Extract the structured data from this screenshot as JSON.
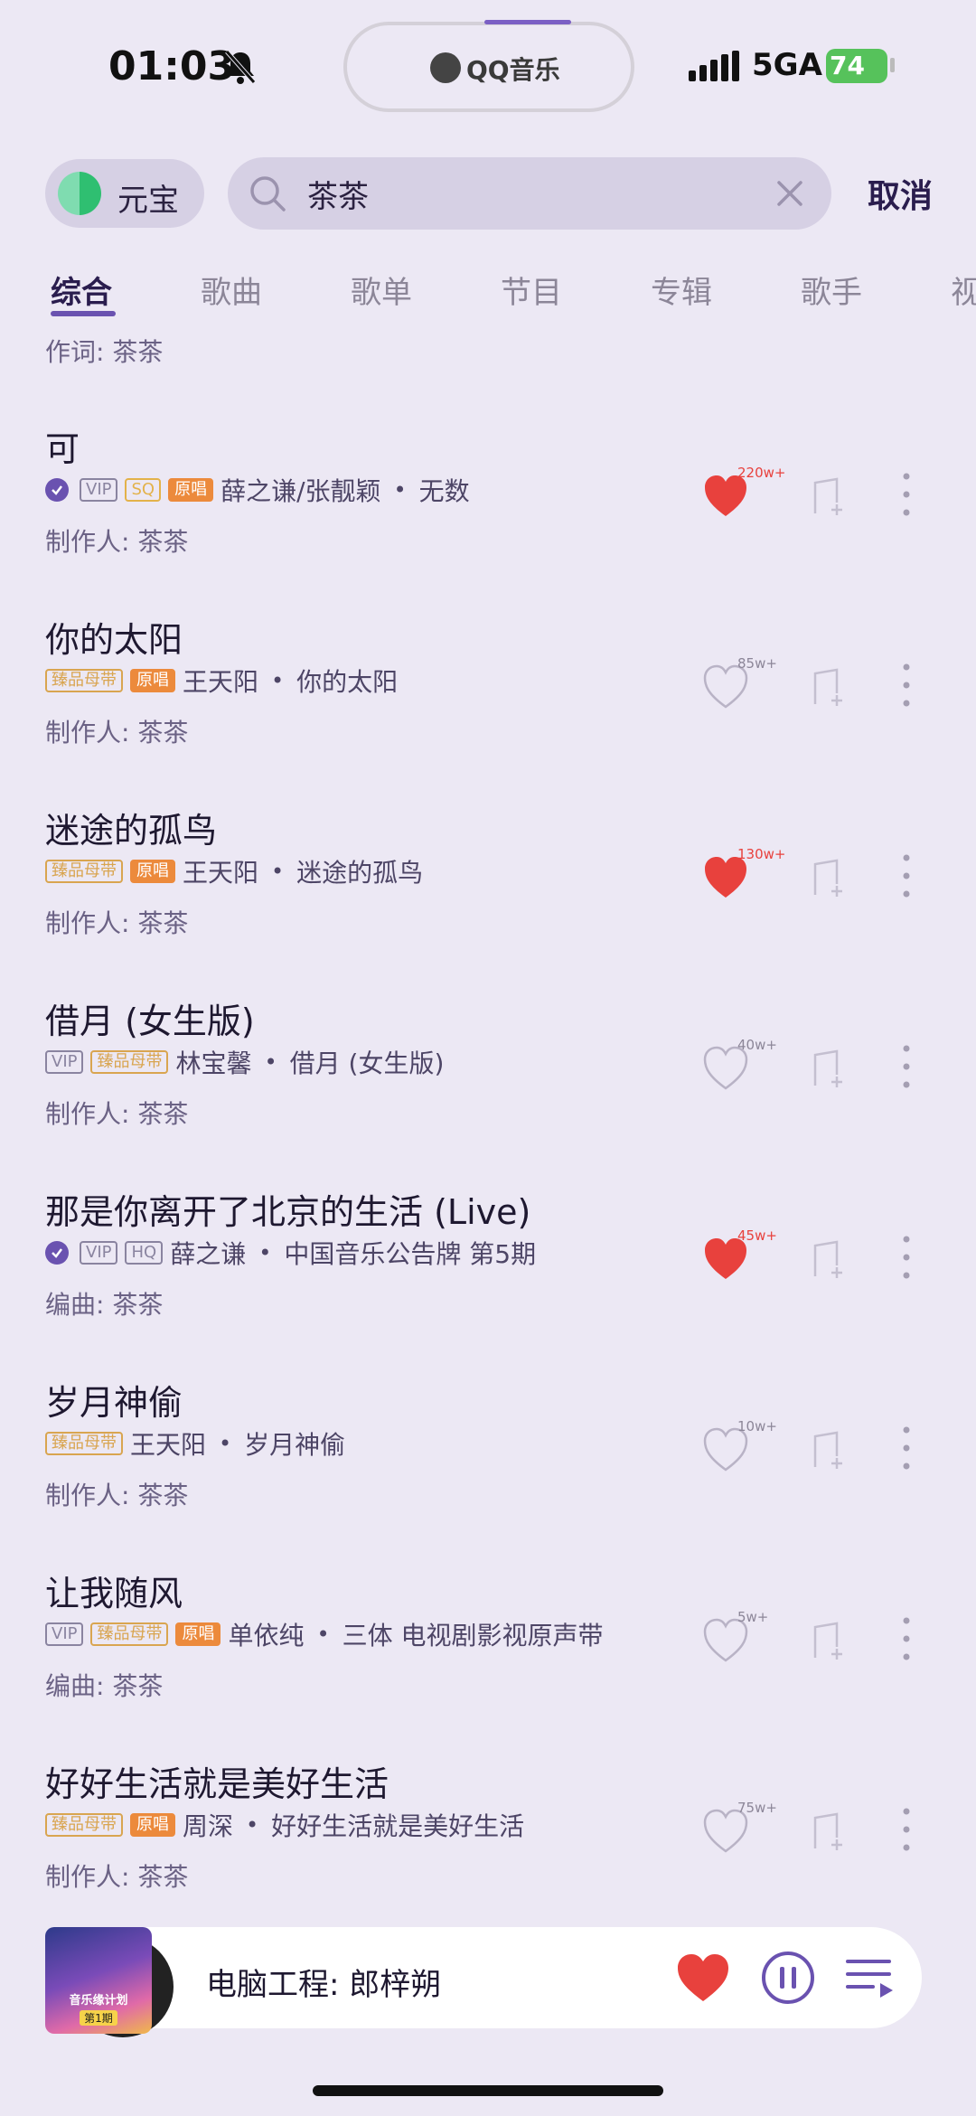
{
  "status_bar": {
    "time": "01:03",
    "island_app": "QQ音乐",
    "network": "5GA",
    "battery": "74"
  },
  "search": {
    "yuanbao_label": "元宝",
    "query": "茶茶",
    "cancel_label": "取消"
  },
  "tabs": [
    "综合",
    "歌曲",
    "歌单",
    "节目",
    "专辑",
    "歌手",
    "视"
  ],
  "lead_credit": "作词: 茶茶",
  "songs": [
    {
      "title": "可",
      "badges": [
        "check",
        "VIP",
        "SQ",
        "原唱"
      ],
      "artist": "薛之谦/张靓颖",
      "album": "无数",
      "liked": true,
      "likes": "220w+",
      "credit": "制作人: 茶茶"
    },
    {
      "title": "你的太阳",
      "badges": [
        "臻品母带",
        "原唱"
      ],
      "artist": "王天阳",
      "album": "你的太阳",
      "liked": false,
      "likes": "85w+",
      "credit": "制作人: 茶茶"
    },
    {
      "title": "迷途的孤鸟",
      "badges": [
        "臻品母带",
        "原唱"
      ],
      "artist": "王天阳",
      "album": "迷途的孤鸟",
      "liked": true,
      "likes": "130w+",
      "credit": "制作人: 茶茶"
    },
    {
      "title": "借月 (女生版)",
      "badges": [
        "VIP",
        "臻品母带"
      ],
      "artist": "林宝馨",
      "album": "借月 (女生版)",
      "liked": false,
      "likes": "40w+",
      "credit": "制作人: 茶茶"
    },
    {
      "title": "那是你离开了北京的生活 (Live)",
      "badges": [
        "check",
        "VIP",
        "HQ"
      ],
      "artist": "薛之谦",
      "album": "中国音乐公告牌 第5期",
      "liked": true,
      "likes": "45w+",
      "credit": "编曲: 茶茶"
    },
    {
      "title": "岁月神偷",
      "badges": [
        "臻品母带"
      ],
      "artist": "王天阳",
      "album": "岁月神偷",
      "liked": false,
      "likes": "10w+",
      "credit": "制作人: 茶茶"
    },
    {
      "title": "让我随风",
      "badges": [
        "VIP",
        "臻品母带",
        "原唱"
      ],
      "artist": "单依纯",
      "album": "三体 电视剧影视原声带",
      "liked": false,
      "likes": "5w+",
      "credit": "编曲: 茶茶"
    },
    {
      "title": "好好生活就是美好生活",
      "badges": [
        "臻品母带",
        "原唱"
      ],
      "artist": "周深",
      "album": "好好生活就是美好生活",
      "liked": false,
      "likes": "75w+",
      "credit": "制作人: 茶茶"
    }
  ],
  "now_playing": {
    "title": "电脑工程: 郎梓朔",
    "cover_text": "音乐缘计划",
    "cover_sub": "第1期",
    "liked": true
  },
  "colors": {
    "background": "#ece8f4",
    "accent": "#6a52b0",
    "like_red": "#e8413d",
    "original_badge": "#ec8a3c",
    "master_badge": "#d9a550"
  },
  "icons": [
    "bell-off-icon",
    "signal-icon",
    "search-icon",
    "clear-icon",
    "heart-icon",
    "add-to-playlist-icon",
    "more-icon",
    "pause-icon",
    "playlist-icon"
  ]
}
